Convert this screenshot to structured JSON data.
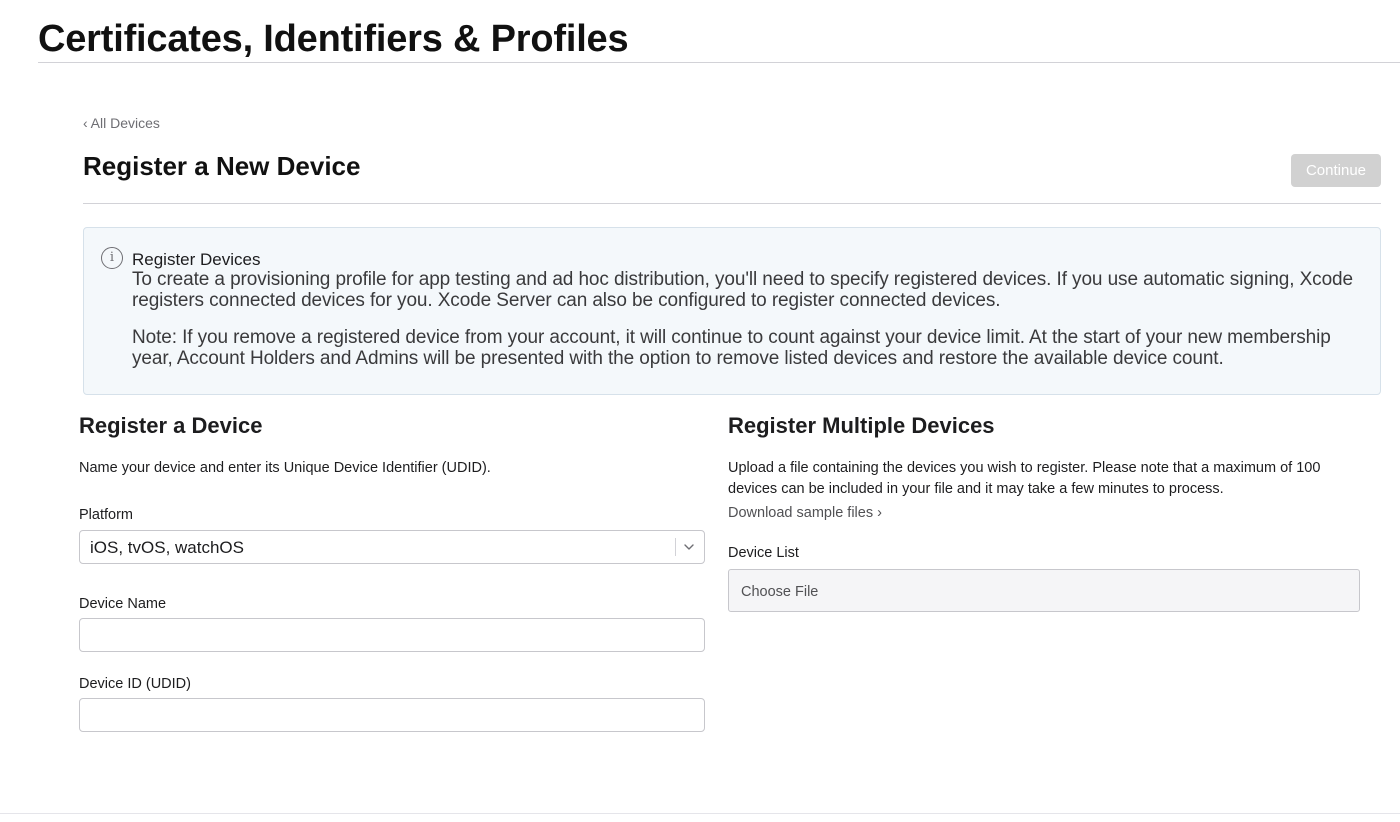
{
  "page": {
    "title": "Certificates, Identifiers & Profiles"
  },
  "nav": {
    "back_chevron": "‹",
    "back_label": "All Devices"
  },
  "header": {
    "title": "Register a New Device",
    "continue_label": "Continue"
  },
  "info": {
    "icon_glyph": "i",
    "heading": "Register Devices",
    "paragraph1": "To create a provisioning profile for app testing and ad hoc distribution, you'll need to specify registered devices. If you use automatic signing, Xcode registers connected devices for you. Xcode Server can also be configured to register connected devices.",
    "paragraph2": "Note: If you remove a registered device from your account, it will continue to count against your device limit. At the start of your new membership year, Account Holders and Admins will be presented with the option to remove listed devices and restore the available device count."
  },
  "single_device": {
    "title": "Register a Device",
    "description": "Name your device and enter its Unique Device Identifier (UDID).",
    "platform_label": "Platform",
    "platform_value": "iOS, tvOS, watchOS",
    "device_name_label": "Device Name",
    "device_name_value": "",
    "device_id_label": "Device ID (UDID)",
    "device_id_value": ""
  },
  "multiple_devices": {
    "title": "Register Multiple Devices",
    "description": "Upload a file containing the devices you wish to register. Please note that a maximum of 100 devices can be included in your file and it may take a few minutes to process.",
    "download_label": "Download sample files ›",
    "device_list_label": "Device List",
    "choose_file_label": "Choose File"
  },
  "colors": {
    "continue_disabled": "#d1d1d1",
    "info_background": "#f4f8fb",
    "info_border": "#d6e1ea",
    "text_primary": "#1d1d1f",
    "text_secondary": "#6e6e73"
  },
  "icons": {
    "info": "info-circle-icon",
    "back": "chevron-left-icon",
    "select": "chevron-down-icon"
  }
}
